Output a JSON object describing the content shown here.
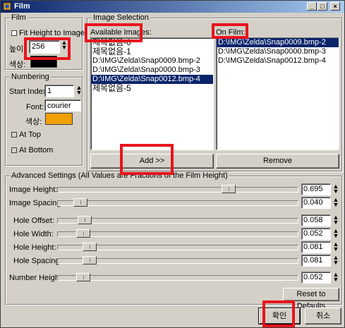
{
  "window": {
    "title": "Film"
  },
  "film": {
    "group_title": "Film",
    "fit_height_label": "Fit Height to Images",
    "height_label": "높이:",
    "height_value": "256",
    "color_label": "색상:",
    "color": "#000000"
  },
  "numbering": {
    "group_title": "Numbering",
    "start_index_label": "Start Index:",
    "start_index_value": "1",
    "font_label": "Font:",
    "font_value": "courier",
    "color_label": "색상:",
    "color": "#f0a000",
    "at_top_label": "At Top",
    "at_bottom_label": "At Bottom"
  },
  "image_selection": {
    "group_title": "Image Selection",
    "available_title": "Available Images:",
    "onfilm_title": "On Film:",
    "available_items": [
      "제목없음-0",
      "제목없음-1",
      "D:\\IMG\\Zelda\\Snap0009.bmp-2",
      "D:\\IMG\\Zelda\\Snap0000.bmp-3",
      "D:\\IMG\\Zelda\\Snap0012.bmp-4",
      "제목없음-5"
    ],
    "onfilm_items": [
      "D:\\IMG\\Zelda\\Snap0009.bmp-2",
      "D:\\IMG\\Zelda\\Snap0000.bmp-3",
      "D:\\IMG\\Zelda\\Snap0012.bmp-4"
    ],
    "add_label": "Add >>",
    "remove_label": "Remove"
  },
  "advanced": {
    "group_title": "Advanced Settings (All Values are Fractions of the Film Height)",
    "rows": [
      {
        "label": "Image Height:",
        "value": "0.695",
        "level": 0.695
      },
      {
        "label": "Image Spacing:",
        "value": "0.040",
        "level": 0.04
      },
      {
        "label": "Hole Offset:",
        "value": "0.058",
        "level": 0.058
      },
      {
        "label": "Hole Width:",
        "value": "0.052",
        "level": 0.052
      },
      {
        "label": "Hole Height:",
        "value": "0.081",
        "level": 0.081
      },
      {
        "label": "Hole Spacing:",
        "value": "0.081",
        "level": 0.081
      },
      {
        "label": "Number Height:",
        "value": "0.052",
        "level": 0.052
      }
    ],
    "reset_label": "Reset to Defaults"
  },
  "footer": {
    "ok_label": "확인",
    "cancel_label": "취소"
  }
}
